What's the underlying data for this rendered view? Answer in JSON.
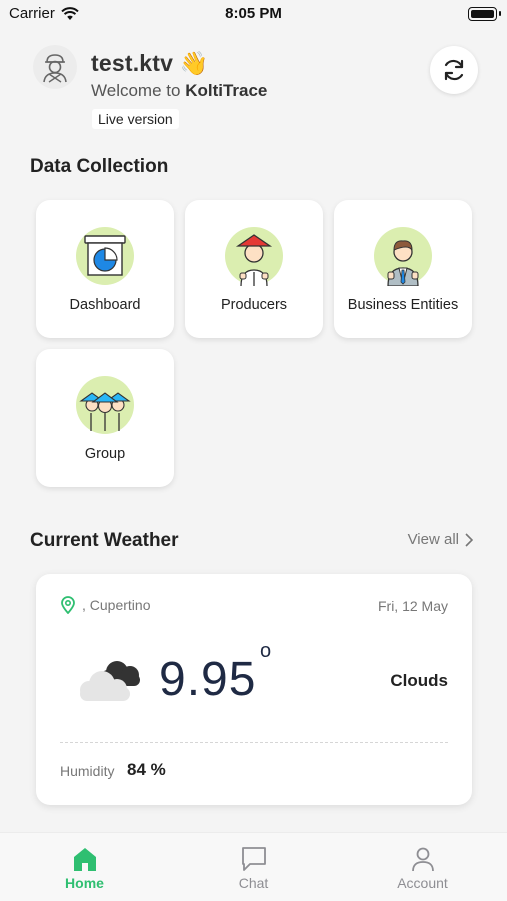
{
  "status_bar": {
    "carrier": "Carrier",
    "time": "8:05 PM"
  },
  "header": {
    "username": "test.ktv",
    "wave_emoji": "👋",
    "welcome_prefix": "Welcome to",
    "app_name": "KoltiTrace",
    "badge": "Live version"
  },
  "data_collection": {
    "title": "Data Collection",
    "tiles": [
      {
        "label": "Dashboard",
        "icon": "dashboard-pie-icon"
      },
      {
        "label": "Producers",
        "icon": "producer-farmer-icon"
      },
      {
        "label": "Business Entities",
        "icon": "business-person-icon"
      },
      {
        "label": "Group",
        "icon": "group-farmers-icon"
      }
    ]
  },
  "weather": {
    "title": "Current Weather",
    "view_all": "View all",
    "location": ", Cupertino",
    "date": "Fri, 12 May",
    "temperature": "9.95",
    "degree_symbol": "o",
    "description": "Clouds",
    "humidity_label": "Humidity",
    "humidity_value": "84 %"
  },
  "tabs": [
    {
      "label": "Home",
      "active": true
    },
    {
      "label": "Chat",
      "active": false
    },
    {
      "label": "Account",
      "active": false
    }
  ],
  "colors": {
    "accent": "#2fbf71",
    "icon_circle": "#dbeeb0",
    "temperature": "#1f2a44"
  }
}
